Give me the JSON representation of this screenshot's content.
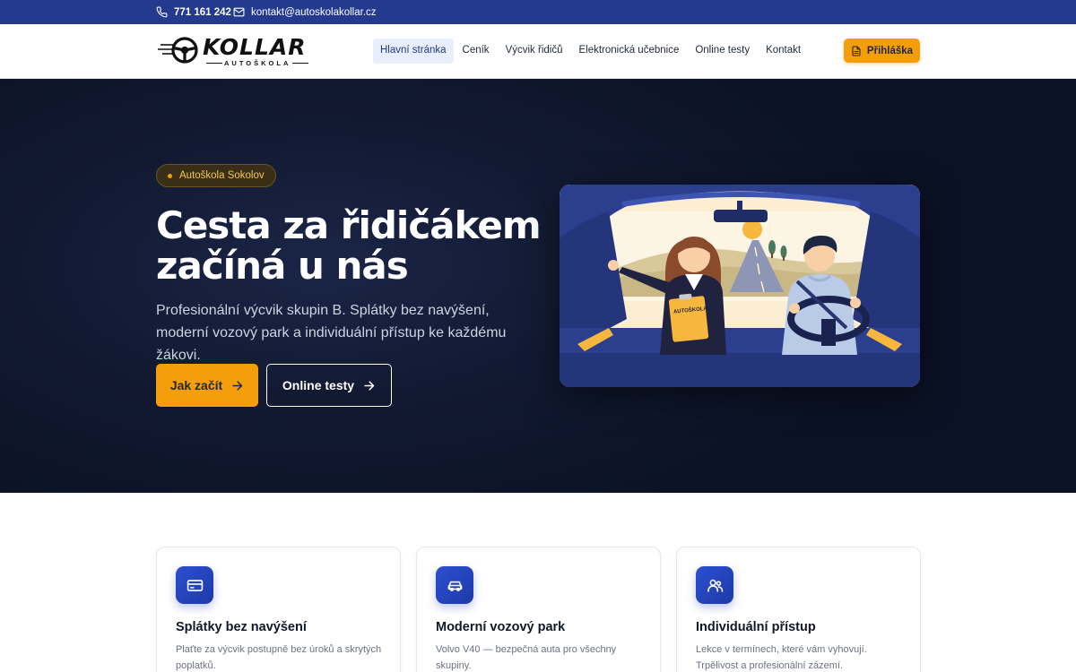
{
  "topbar": {
    "phone": "771 161 242",
    "email": "kontakt@autoskolakollar.cz",
    "background": "#233a8f"
  },
  "logo": {
    "brand": "KOLLAR",
    "subtitle": "AUTOŠKOLA"
  },
  "nav": {
    "items": [
      {
        "label": "Hlavní stránka",
        "active": true
      },
      {
        "label": "Ceník",
        "active": false
      },
      {
        "label": "Výcvik řidičů",
        "active": false
      },
      {
        "label": "Elektronická učebnice",
        "active": false
      },
      {
        "label": "Online testy",
        "active": false
      },
      {
        "label": "Kontakt",
        "active": false
      }
    ],
    "cta_label": "Přihláška"
  },
  "hero": {
    "badge": "Autoškola Sokolov",
    "title_line1": "Cesta za řidičákem",
    "title_line2": "začíná u nás",
    "description": "Profesionální výcvik skupin B. Splátky bez navýšení, moderní vozový park a individuální přístup ke každému žákovi.",
    "primary_button": "Jak začít",
    "secondary_button": "Online testy",
    "illustration_sign": "AUTOŠKOLA"
  },
  "features": [
    {
      "icon": "credit-card-icon",
      "title": "Splátky bez navýšení",
      "description": "Plaťte za výcvik postupně bez úroků a skrytých poplatků."
    },
    {
      "icon": "car-icon",
      "title": "Moderní vozový park",
      "description": "Volvo V40 — bezpečná auta pro všechny skupiny."
    },
    {
      "icon": "users-icon",
      "title": "Individuální přístup",
      "description": "Lekce v termínech, které vám vyhovují. Trpělivost a profesionální zázemí."
    }
  ],
  "colors": {
    "accent": "#f59e0b",
    "primary": "#233a8f",
    "hero_bg": "#0f172a"
  }
}
